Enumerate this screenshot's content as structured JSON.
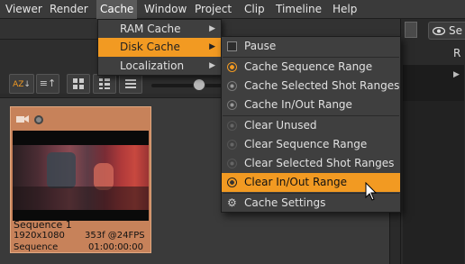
{
  "menubar": {
    "items": [
      "Viewer",
      "Render",
      "Cache",
      "Window",
      "Project",
      "Clip",
      "Timeline",
      "Help"
    ]
  },
  "right_panel": {
    "tab_label": "Se",
    "letter": "R"
  },
  "bin_toolbar": {
    "sort_button": "AZ",
    "view_buttons": [
      "thumbnail-grid",
      "thumbnail-list",
      "list"
    ]
  },
  "clip": {
    "name": "Sequence 1",
    "resolution": "1920x1080",
    "frames_fps": "353f @24FPS",
    "type": "Sequence",
    "timecode": "01:00:00:00"
  },
  "cache_menu": {
    "items": [
      {
        "label": "RAM Cache",
        "has_submenu": true
      },
      {
        "label": "Disk Cache",
        "has_submenu": true,
        "highlighted": true
      },
      {
        "label": "Localization",
        "has_submenu": true
      }
    ]
  },
  "disk_cache_menu": {
    "items": [
      {
        "label": "Pause",
        "icon": "checkbox-icon"
      },
      {
        "label": "Cache Sequence Range",
        "icon": "cache-active-icon"
      },
      {
        "label": "Cache Selected Shot Ranges",
        "icon": "cache-icon"
      },
      {
        "label": "Cache In/Out Range",
        "icon": "cache-icon"
      },
      {
        "label": "Clear Unused",
        "icon": "clear-icon"
      },
      {
        "label": "Clear Sequence Range",
        "icon": "clear-icon"
      },
      {
        "label": "Clear Selected Shot Ranges",
        "icon": "clear-icon"
      },
      {
        "label": "Clear In/Out Range",
        "icon": "clear-icon",
        "highlighted": true
      },
      {
        "label": "Cache Settings",
        "icon": "gear-icon"
      }
    ]
  },
  "colors": {
    "accent": "#f29a22",
    "clip_card": "#c7825a"
  }
}
